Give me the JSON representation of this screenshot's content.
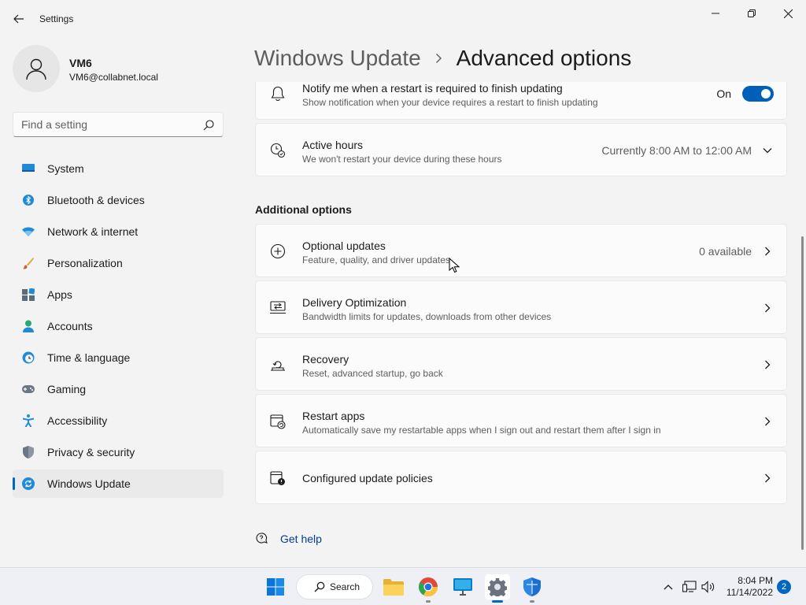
{
  "window": {
    "app_title": "Settings"
  },
  "profile": {
    "name": "VM6",
    "email": "VM6@collabnet.local"
  },
  "search": {
    "placeholder": "Find a setting"
  },
  "sidebar": {
    "items": [
      {
        "label": "System",
        "icon": "system-icon"
      },
      {
        "label": "Bluetooth & devices",
        "icon": "bluetooth-icon"
      },
      {
        "label": "Network & internet",
        "icon": "wifi-icon"
      },
      {
        "label": "Personalization",
        "icon": "brush-icon"
      },
      {
        "label": "Apps",
        "icon": "apps-icon"
      },
      {
        "label": "Accounts",
        "icon": "accounts-icon"
      },
      {
        "label": "Time & language",
        "icon": "clock-globe-icon"
      },
      {
        "label": "Gaming",
        "icon": "gamepad-icon"
      },
      {
        "label": "Accessibility",
        "icon": "accessibility-icon"
      },
      {
        "label": "Privacy & security",
        "icon": "shield-icon"
      },
      {
        "label": "Windows Update",
        "icon": "update-icon",
        "selected": true
      }
    ]
  },
  "breadcrumb": {
    "parent": "Windows Update",
    "current": "Advanced options"
  },
  "cards": {
    "notify": {
      "title": "Notify me when a restart is required to finish updating",
      "desc": "Show notification when your device requires a restart to finish updating",
      "state": "On"
    },
    "active_hours": {
      "title": "Active hours",
      "desc": "We won't restart your device during these hours",
      "value": "Currently 8:00 AM to 12:00 AM"
    }
  },
  "additional": {
    "heading": "Additional options",
    "items": [
      {
        "title": "Optional updates",
        "desc": "Feature, quality, and driver updates",
        "right": "0 available"
      },
      {
        "title": "Delivery Optimization",
        "desc": "Bandwidth limits for updates, downloads from other devices",
        "right": ""
      },
      {
        "title": "Recovery",
        "desc": "Reset, advanced startup, go back",
        "right": ""
      },
      {
        "title": "Restart apps",
        "desc": "Automatically save my restartable apps when I sign out and restart them after I sign in",
        "right": ""
      },
      {
        "title": "Configured update policies",
        "desc": "",
        "right": ""
      }
    ]
  },
  "help": {
    "label": "Get help"
  },
  "taskbar": {
    "search_label": "Search",
    "time": "8:04 PM",
    "date": "11/14/2022",
    "notification_count": "2"
  },
  "colors": {
    "accent": "#005fb8",
    "link": "#003e92"
  }
}
